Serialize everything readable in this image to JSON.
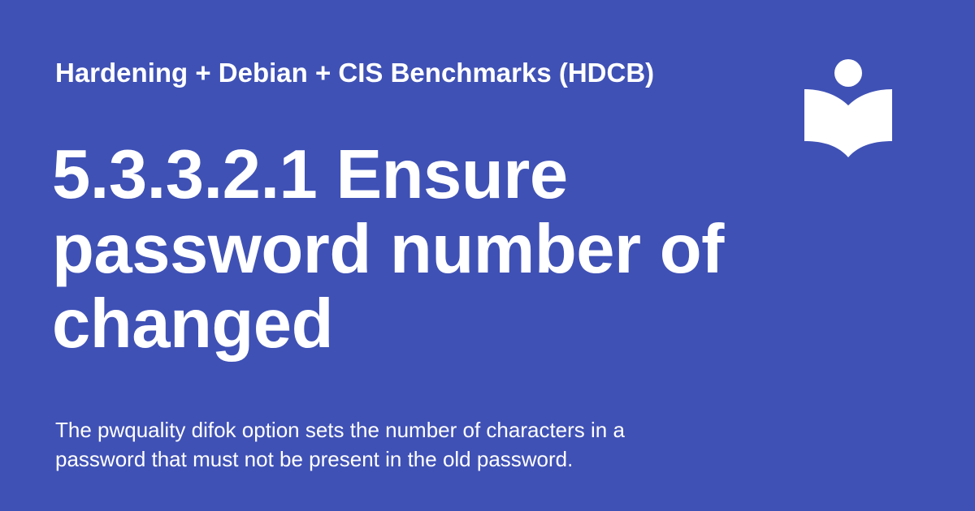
{
  "site": {
    "name": "Hardening + Debian + CIS Benchmarks (HDCB)"
  },
  "page": {
    "title": "5.3.3.2.1 Ensure password number of changed",
    "description": "The pwquality difok option sets the number of characters in a password that must not be present in the old password."
  },
  "logo": {
    "icon": "reading-person-book-icon"
  },
  "colors": {
    "background": "#3f51b5",
    "text": "#ffffff"
  }
}
